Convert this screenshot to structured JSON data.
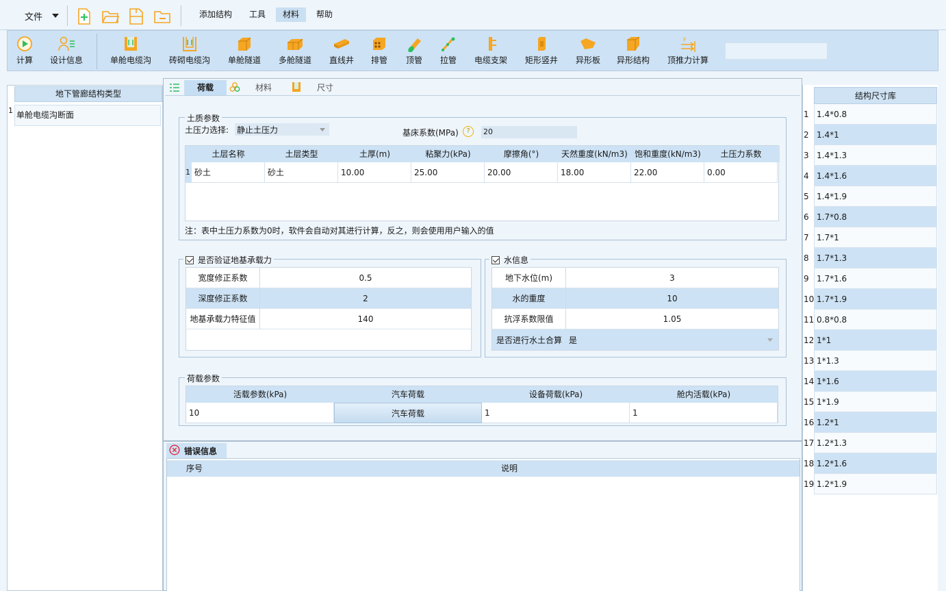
{
  "menu": {
    "file": "文件",
    "items": [
      "添加结构",
      "工具",
      "材料",
      "帮助"
    ],
    "active": "材料"
  },
  "ribbon": {
    "buttons": [
      {
        "label": "计算",
        "icon": "play-circle-icon"
      },
      {
        "label": "设计信息",
        "icon": "user-list-icon"
      },
      {
        "label": "单舱电缆沟",
        "icon": "channel-icon"
      },
      {
        "label": "砖砌电缆沟",
        "icon": "channel-outline-icon"
      },
      {
        "label": "单舱隧道",
        "icon": "box-icon"
      },
      {
        "label": "多舱隧道",
        "icon": "multi-box-icon"
      },
      {
        "label": "直线井",
        "icon": "beam-icon"
      },
      {
        "label": "排管",
        "icon": "pipe-bank-icon"
      },
      {
        "label": "顶管",
        "icon": "pipe-icon"
      },
      {
        "label": "拉管",
        "icon": "pull-pipe-icon"
      },
      {
        "label": "电缆支架",
        "icon": "bracket-icon"
      },
      {
        "label": "矩形竖井",
        "icon": "shaft-icon"
      },
      {
        "label": "异形板",
        "icon": "plate-icon"
      },
      {
        "label": "异形结构",
        "icon": "shape-icon"
      },
      {
        "label": "顶推力计算",
        "icon": "push-force-icon"
      }
    ]
  },
  "left_panel": {
    "header": "地下管廊结构类型",
    "rows": [
      {
        "num": "1",
        "label": "单舱电缆沟断面"
      }
    ]
  },
  "tabs": [
    {
      "label": "荷载",
      "icon": "list-icon"
    },
    {
      "label": "材料",
      "icon": "materials-icon"
    },
    {
      "label": "尺寸",
      "icon": "size-icon"
    }
  ],
  "soil": {
    "legend": "土质参数",
    "pressure_label": "土压力选择:",
    "pressure_value": "静止土压力",
    "bed_label": "基床系数(MPa)",
    "bed_value": "20",
    "columns": [
      "土层名称",
      "土层类型",
      "土厚(m)",
      "粘聚力(kPa)",
      "摩擦角(°)",
      "天然重度(kN/m3)",
      "饱和重度(kN/m3)",
      "土压力系数"
    ],
    "rows": [
      {
        "num": "1",
        "cells": [
          "砂土",
          "砂土",
          "10.00",
          "25.00",
          "20.00",
          "18.00",
          "22.00",
          "0.00"
        ]
      }
    ],
    "note": "注：表中土压力系数为0时，软件会自动对其进行计算，反之，则会使用用户输入的值"
  },
  "bearing": {
    "legend": "是否验证地基承载力",
    "rows": [
      {
        "label": "宽度修正系数",
        "value": "0.5"
      },
      {
        "label": "深度修正系数",
        "value": "2"
      },
      {
        "label": "地基承载力特征值",
        "value": "140"
      }
    ]
  },
  "water": {
    "legend": "水信息",
    "rows": [
      {
        "label": "地下水位(m)",
        "value": "3"
      },
      {
        "label": "水的重度",
        "value": "10"
      },
      {
        "label": "抗浮系数限值",
        "value": "1.05"
      }
    ],
    "combine_label": "是否进行水土合算",
    "combine_value": "是"
  },
  "load": {
    "legend": "荷载参数",
    "columns": [
      "活载参数(kPa)",
      "汽车荷载",
      "设备荷载(kPa)",
      "舱内活载(kPa)"
    ],
    "values": [
      "10",
      "汽车荷载",
      "1",
      "1"
    ]
  },
  "error": {
    "tab": "错误信息",
    "columns": [
      "序号",
      "说明"
    ]
  },
  "right_panel": {
    "header": "结构尺寸库",
    "rows": [
      "1.4*0.8",
      "1.4*1",
      "1.4*1.3",
      "1.4*1.6",
      "1.4*1.9",
      "1.7*0.8",
      "1.7*1",
      "1.7*1.3",
      "1.7*1.6",
      "1.7*1.9",
      "0.8*0.8",
      "1*1",
      "1*1.3",
      "1*1.6",
      "1*1.9",
      "1.2*1",
      "1.2*1.3",
      "1.2*1.6",
      "1.2*1.9"
    ]
  },
  "colors": {
    "accent": "#f5a623",
    "header_bg": "#cde2f4",
    "panel_bg": "#eef5fb"
  }
}
